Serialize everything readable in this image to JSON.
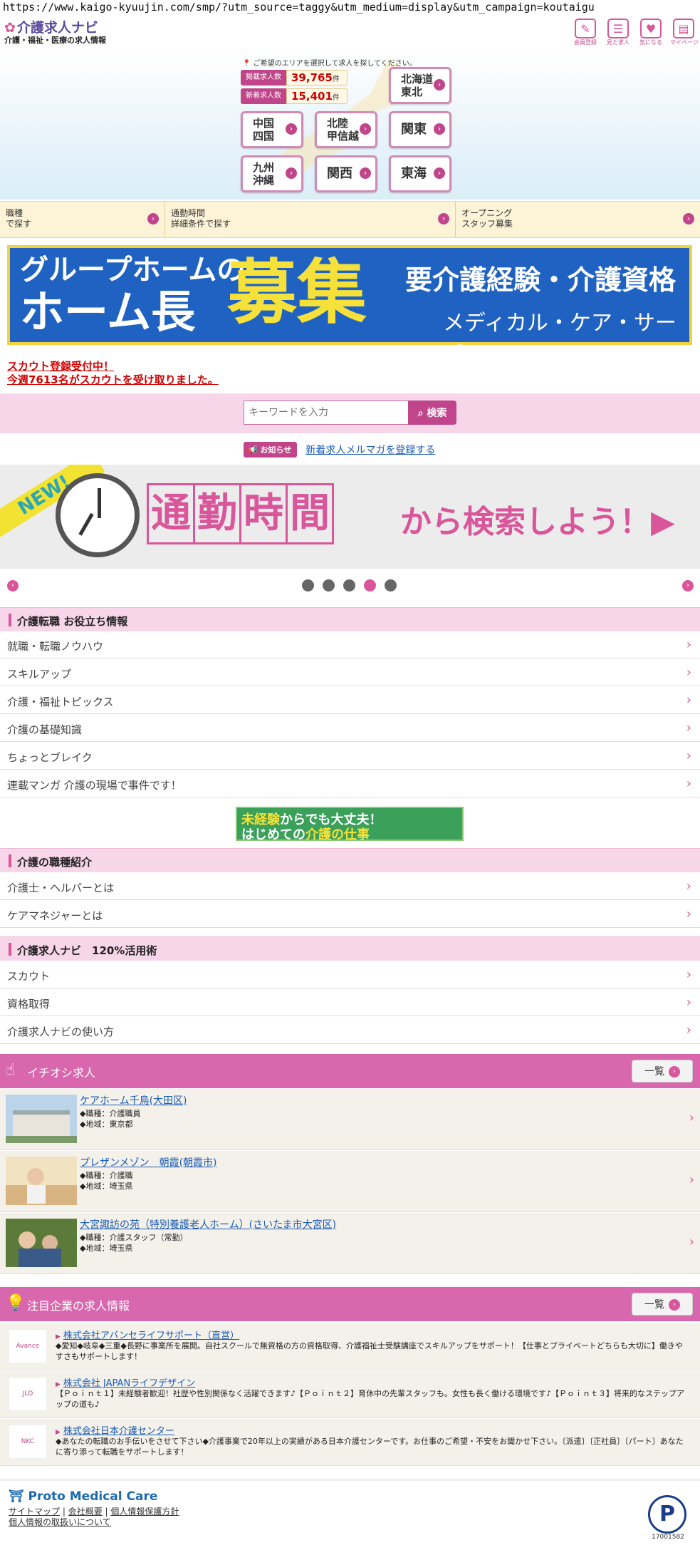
{
  "url": "https://www.kaigo-kyuujin.com/smp/?utm_source=taggy&utm_medium=display&utm_campaign=koutaigu",
  "header": {
    "logo_main": "介護求人ナビ",
    "logo_sub": "介護・福祉・医療の求人情報",
    "nav": [
      {
        "label": "会員登録",
        "icon": "pencil-icon"
      },
      {
        "label": "見た求人",
        "icon": "history-icon"
      },
      {
        "label": "気になる",
        "icon": "heart-icon"
      },
      {
        "label": "マイページ",
        "icon": "mypage-icon"
      }
    ]
  },
  "map": {
    "prompt": "ご希望のエリアを選択して求人を探してください。",
    "posted_label": "掲載求人数",
    "posted_count": "39,765",
    "new_label": "新着求人数",
    "new_count": "15,401",
    "count_unit": "件",
    "regions": {
      "hokkaido": [
        "北海道",
        "東北"
      ],
      "chugoku": [
        "中国",
        "四国"
      ],
      "hokuriku": [
        "北陸",
        "甲信越"
      ],
      "kanto": [
        "関東"
      ],
      "kyushu": [
        "九州",
        "沖縄"
      ],
      "kansai": [
        "関西"
      ],
      "tokai": [
        "東海"
      ]
    }
  },
  "search_tabs": [
    [
      "職種",
      "で探す"
    ],
    [
      "通勤時間",
      "詳細条件で探す"
    ],
    [
      "オープニング",
      "スタッフ募集"
    ]
  ],
  "banner1": {
    "line1": "グループホームの",
    "line2": "ホーム長",
    "big": "募集",
    "right1": "要介護経験・介護資格",
    "right2": "メディカル・ケア・サービス"
  },
  "scout": {
    "line1": "スカウト登録受付中！",
    "line2": "今週7613名がスカウトを受け取りました。"
  },
  "search": {
    "placeholder": "キーワードを入力",
    "button": "検索"
  },
  "notice": {
    "badge": "お知らせ",
    "link": "新着求人メルマガを登録する"
  },
  "banner2": {
    "new": "NEW!",
    "kanji": [
      "通",
      "勤",
      "時",
      "間"
    ],
    "tail": "から検索しよう！▶"
  },
  "carousel": {
    "slides": 5,
    "active": 4
  },
  "section1": {
    "title": "介護転職 お役立ち情報",
    "items": [
      "就職・転職ノウハウ",
      "スキルアップ",
      "介護・福祉トピックス",
      "介護の基礎知識",
      "ちょっとブレイク",
      "連載マンガ 介護の現場で事件です！"
    ]
  },
  "mini_banner": {
    "line1a": "未経験",
    "line1b": "からでも大丈夫！",
    "line2a": "はじめての",
    "line2b": "介護の仕事"
  },
  "section2": {
    "title": "介護の職種紹介",
    "items": [
      "介護士・ヘルパーとは",
      "ケアマネジャーとは"
    ]
  },
  "section3": {
    "title": "介護求人ナビ　120%活用術",
    "items": [
      "スカウト",
      "資格取得",
      "介護求人ナビの使い方"
    ]
  },
  "featured": {
    "title": "イチオシ求人",
    "list_button": "一覧",
    "jobs": [
      {
        "name": "ケアホーム千鳥(大田区)",
        "type": "◆職種：介護職員",
        "area": "◆地域：東京都"
      },
      {
        "name": "プレザンメゾン　朝霞(朝霞市)",
        "type": "◆職種：介護職",
        "area": "◆地域：埼玉県"
      },
      {
        "name": "大宮諏訪の苑（特別養護老人ホーム）(さいたま市大宮区)",
        "type": "◆職種：介護スタッフ（常勤）",
        "area": "◆地域：埼玉県"
      }
    ]
  },
  "companies": {
    "title": "注目企業の求人情報",
    "list_button": "一覧",
    "items": [
      {
        "name": "株式会社アバンセライフサポート（直営）",
        "logo": "Avance",
        "desc": "◆愛知◆岐阜◆三重◆長野に事業所を展開。自社スクールで無資格の方の資格取得、介護福祉士受験講座でスキルアップをサポート！【仕事とプライベートどちらも大切に】働きやすさもサポートします！"
      },
      {
        "name": "株式会社 JAPANライフデザイン",
        "logo": "JLD",
        "desc": "【Ｐｏｉｎｔ１】未経験者歓迎！社歴や性別関係なく活躍できます♪【Ｐｏｉｎｔ２】育休中の先輩スタッフも。女性も長く働ける環境です♪【Ｐｏｉｎｔ３】将来的なステップアップの道も♪"
      },
      {
        "name": "株式会社日本介護センター",
        "logo": "NKC",
        "desc": "◆あなたの転職のお手伝いをさせて下さい◆介護事業で20年以上の実績がある日本介護センターです。お仕事のご希望・不安をお聞かせ下さい。〔派遣〕〔正社員〕〔パート〕あなたに寄り添って転職をサポートします！"
      }
    ]
  },
  "footer": {
    "brand": "Proto Medical Care",
    "links": [
      "サイトマップ",
      "会社概要",
      "個人情報保護方針",
      "個人情報の取扱いについて"
    ],
    "privacy_number": "17001582"
  }
}
